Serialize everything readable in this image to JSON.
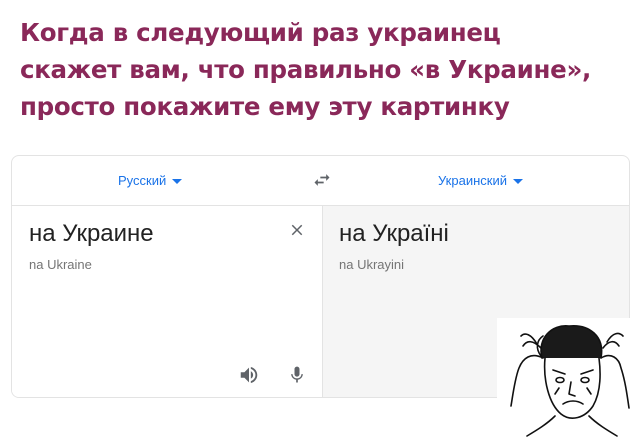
{
  "headline": {
    "line1": "Когда в следующий раз украинец",
    "line2": "скажет вам, что правильно «в Украине»,",
    "line3": "просто покажите ему эту картинку"
  },
  "translator": {
    "source_language": "Русский",
    "target_language": "Украинский",
    "source_text": "на Украине",
    "source_transliteration": "na Ukraine",
    "target_text": "на Україні",
    "target_transliteration": "na Ukrayini",
    "icons": {
      "swap": "swap-languages-icon",
      "clear": "close-icon",
      "speaker": "speaker-icon",
      "mic": "microphone-icon"
    },
    "accent_color": "#1a73e8"
  },
  "colors": {
    "headline": "#8a2859",
    "target_pane_bg": "#f5f5f5"
  },
  "meme": {
    "icon": "distressed-face-meme-icon"
  }
}
